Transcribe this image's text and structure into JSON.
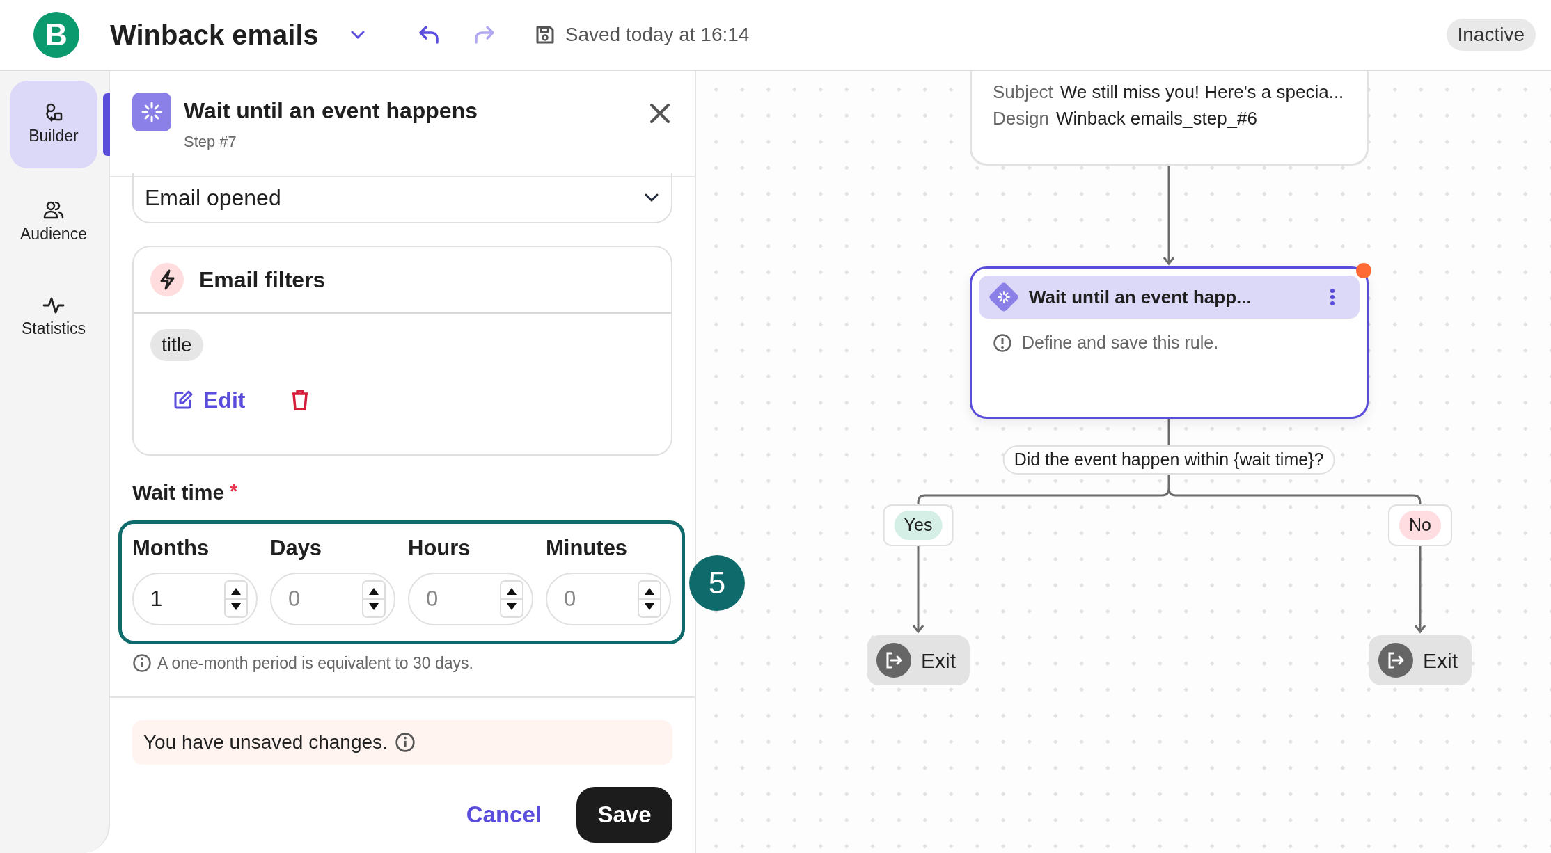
{
  "header": {
    "logo_letter": "B",
    "title": "Winback emails",
    "save_status": "Saved today at 16:14",
    "status_badge": "Inactive"
  },
  "sidebar": {
    "items": [
      {
        "label": "Builder",
        "selected": true
      },
      {
        "label": "Audience",
        "selected": false
      },
      {
        "label": "Statistics",
        "selected": false
      }
    ]
  },
  "panel": {
    "title": "Wait until an event happens",
    "subtitle": "Step #7",
    "event_select": {
      "value": "Email opened"
    },
    "filters": {
      "title": "Email filters",
      "tags": [
        "title"
      ],
      "edit_label": "Edit"
    },
    "wait_time": {
      "label": "Wait time",
      "required_mark": "*",
      "callout": "5",
      "fields": [
        {
          "label": "Months",
          "value": "1"
        },
        {
          "label": "Days",
          "placeholder": "0"
        },
        {
          "label": "Hours",
          "placeholder": "0"
        },
        {
          "label": "Minutes",
          "placeholder": "0"
        }
      ]
    },
    "note": "A one-month period is equivalent to 30 days.",
    "unsaved_banner": "You have unsaved changes.",
    "buttons": {
      "cancel": "Cancel",
      "save": "Save"
    }
  },
  "canvas": {
    "email_node": {
      "rows": [
        {
          "label": "Subject",
          "value": "We still miss you! Here's a specia..."
        },
        {
          "label": "Design",
          "value": "Winback emails_step_#6"
        }
      ]
    },
    "wait_node": {
      "title": "Wait until an event happ...",
      "message": "Define and save this rule.",
      "selected": true,
      "alert": true
    },
    "question": "Did the event happen within {wait time}?",
    "branches": [
      {
        "label": "Yes",
        "color": "#d6efe6",
        "exit_label": "Exit"
      },
      {
        "label": "No",
        "color": "#ffdde0",
        "exit_label": "Exit"
      }
    ]
  }
}
